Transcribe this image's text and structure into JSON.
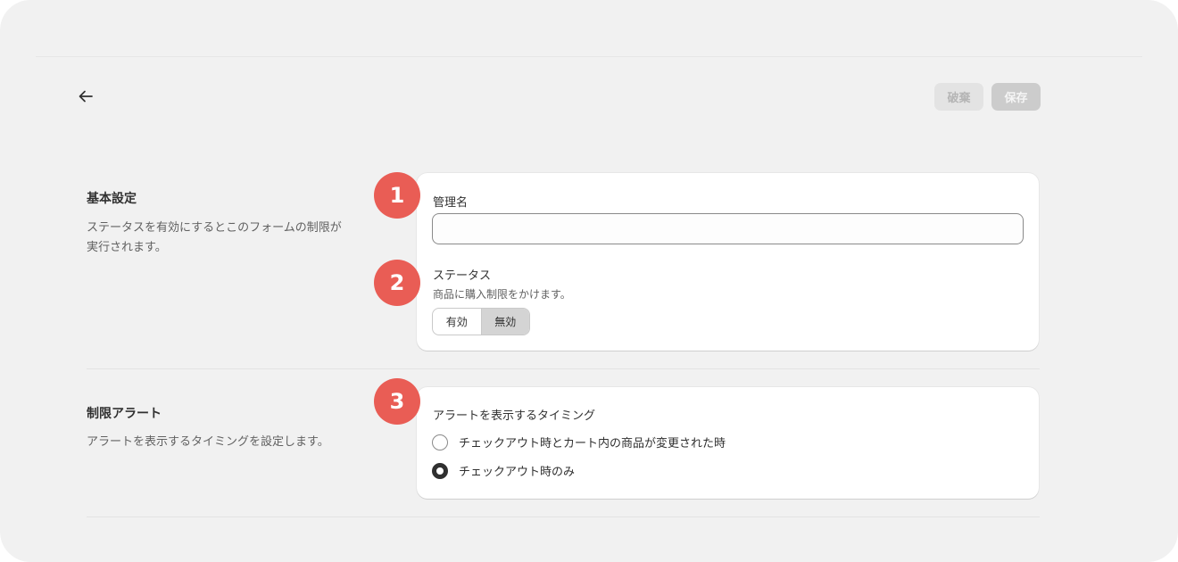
{
  "header": {
    "back_icon": "arrow-left-icon",
    "discard_label": "破棄",
    "save_label": "保存"
  },
  "section_basic": {
    "title": "基本設定",
    "description": "ステータスを有効にするとこのフォームの制限が実行されます。",
    "description_line1": "ステータスを有効にするとこのフォームの制限が",
    "description_line2": "実行されます。"
  },
  "card_basic": {
    "name_label": "管理名",
    "name_value": "",
    "status_label": "ステータス",
    "status_help": "商品に購入制限をかけます。",
    "status_options": [
      "有効",
      "無効"
    ],
    "status_selected": "無効"
  },
  "section_alert": {
    "title": "制限アラート",
    "description": "アラートを表示するタイミングを設定します。"
  },
  "card_alert": {
    "timing_label": "アラートを表示するタイミング",
    "options": [
      "チェックアウト時とカート内の商品が変更された時",
      "チェックアウト時のみ"
    ],
    "selected": "チェックアウト時のみ"
  },
  "badges": [
    "1",
    "2",
    "3"
  ],
  "colors": {
    "badge": "#e95d55",
    "background": "#f1f1f1",
    "card": "#ffffff"
  }
}
